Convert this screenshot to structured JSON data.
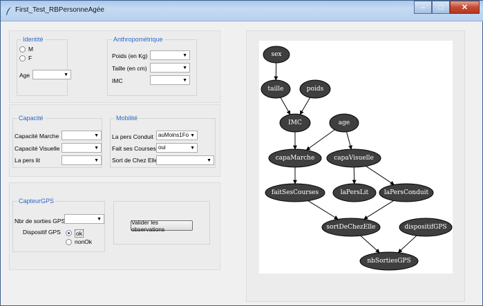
{
  "window": {
    "title": "First_Test_RBPersonneAgée"
  },
  "identite": {
    "title": "Identité",
    "sex_options": [
      "M",
      "F"
    ],
    "age_label": "Age",
    "age_value": ""
  },
  "anthropometrique": {
    "title": "Anthropométrique",
    "fields": [
      {
        "label": "Poids (en Kg)",
        "value": ""
      },
      {
        "label": "Taille (en cm)",
        "value": ""
      },
      {
        "label": "IMC",
        "value": ""
      }
    ]
  },
  "capacite": {
    "title": "Capacité",
    "fields": [
      {
        "label": "Capacité Marche",
        "value": ""
      },
      {
        "label": "Capacité Visuelle",
        "value": ""
      },
      {
        "label": "La pers lit",
        "value": ""
      }
    ]
  },
  "mobilite": {
    "title": "Mobilité",
    "fields": [
      {
        "label": "La pers Conduit",
        "value": "auMoins1Fo"
      },
      {
        "label": "Fait ses Courses",
        "value": "oui"
      },
      {
        "label": "Sort de Chez Elle",
        "value": ""
      }
    ]
  },
  "capteur": {
    "title": "CapteurGPS",
    "nbr_label": "Nbr de sorties GPS",
    "nbr_value": "",
    "dispositif_label": "Dispositif GPS",
    "dispositif_options": [
      "ok",
      "nonOk"
    ],
    "dispositif_selected": "ok"
  },
  "validate_label": "Valider les observations",
  "graph": {
    "nodes": [
      {
        "id": "sex",
        "label": "sex"
      },
      {
        "id": "taille",
        "label": "taille"
      },
      {
        "id": "poids",
        "label": "poids"
      },
      {
        "id": "IMC",
        "label": "IMC"
      },
      {
        "id": "age",
        "label": "age"
      },
      {
        "id": "capaMarche",
        "label": "capaMarche"
      },
      {
        "id": "capaVisuelle",
        "label": "capaVisuelle"
      },
      {
        "id": "faitSesCourses",
        "label": "faitSesCourses"
      },
      {
        "id": "laPersLit",
        "label": "laPersLit"
      },
      {
        "id": "laPersConduit",
        "label": "laPersConduit"
      },
      {
        "id": "sortDeChezElle",
        "label": "sortDeChezElle"
      },
      {
        "id": "dispositifGPS",
        "label": "dispositifGPS"
      },
      {
        "id": "nbSortiesGPS",
        "label": "nbSortiesGPS"
      }
    ],
    "edges": [
      [
        "sex",
        "taille"
      ],
      [
        "taille",
        "IMC"
      ],
      [
        "poids",
        "IMC"
      ],
      [
        "IMC",
        "capaMarche"
      ],
      [
        "age",
        "capaMarche"
      ],
      [
        "age",
        "capaVisuelle"
      ],
      [
        "capaMarche",
        "faitSesCourses"
      ],
      [
        "capaVisuelle",
        "laPersLit"
      ],
      [
        "capaVisuelle",
        "laPersConduit"
      ],
      [
        "faitSesCourses",
        "sortDeChezElle"
      ],
      [
        "laPersConduit",
        "sortDeChezElle"
      ],
      [
        "sortDeChezElle",
        "nbSortiesGPS"
      ],
      [
        "dispositifGPS",
        "nbSortiesGPS"
      ]
    ]
  }
}
